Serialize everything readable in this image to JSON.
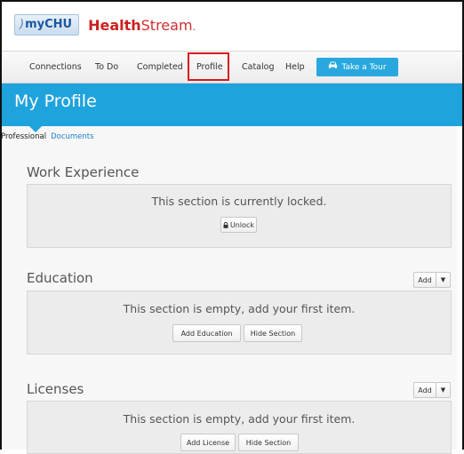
{
  "logo": {
    "mychu_prefix": ")",
    "mychu_brand": "myCHU",
    "healthstream_bold": "Health",
    "healthstream_rest": "Stream",
    "healthstream_mark": "."
  },
  "nav": {
    "items": [
      {
        "label": "Connections"
      },
      {
        "label": "To Do"
      },
      {
        "label": "Completed"
      },
      {
        "label": "Profile"
      },
      {
        "label": "Catalog"
      },
      {
        "label": "Help"
      }
    ],
    "tour_label": "Take a Tour"
  },
  "page_title": "My Profile",
  "subtabs": {
    "professional": "Professional",
    "documents": "Documents"
  },
  "sections": {
    "work_experience": {
      "title": "Work Experience",
      "message": "This section is currently locked.",
      "unlock_label": "Unlock"
    },
    "education": {
      "title": "Education",
      "add_label": "Add",
      "message": "This section is empty, add your first item.",
      "primary_label": "Add Education",
      "hide_label": "Hide Section"
    },
    "licenses": {
      "title": "Licenses",
      "add_label": "Add",
      "message": "This section is empty, add your first item.",
      "primary_label": "Add License",
      "hide_label": "Hide Section"
    }
  },
  "colors": {
    "accent": "#1fa3dc",
    "brand_red": "#cc2020",
    "highlight": "#d9181f",
    "tour_button": "#28a8de"
  }
}
